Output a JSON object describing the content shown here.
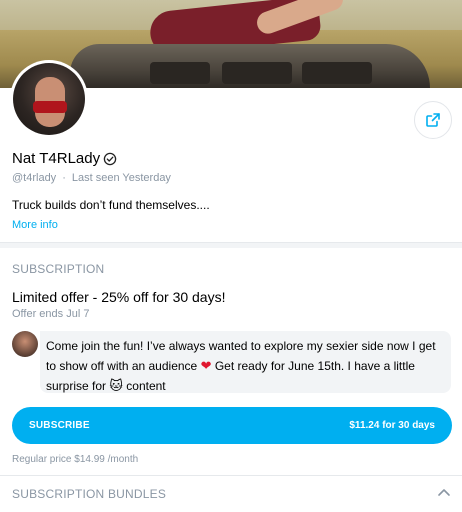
{
  "profile": {
    "display_name": "Nat T4RLady",
    "handle": "@t4rlady",
    "separator": "·",
    "last_seen": "Last seen Yesterday",
    "bio": "Truck builds don’t fund themselves....",
    "more_info_label": "More info"
  },
  "subscription": {
    "section_title": "SUBSCRIPTION",
    "offer_title": "Limited offer - 25% off for 30 days!",
    "offer_ends": "Offer ends Jul 7",
    "message_part1": "Come join the fun! I’ve always wanted to explore my sexier side now I get to show off with an audience",
    "message_part2": "Get ready for June 15th. I have a little surprise for",
    "message_part3": "content",
    "heart_emoji": "❤",
    "cat_emoji": "🐱",
    "subscribe_label": "SUBSCRIBE",
    "price_label": "$11.24 for 30 days",
    "regular_price": "Regular price $14.99 /month"
  },
  "bundles": {
    "section_title": "SUBSCRIPTION BUNDLES"
  },
  "icons": {
    "share": "share-icon",
    "verified": "verified-badge-icon",
    "collapse": "chevron-up-icon"
  },
  "colors": {
    "accent": "#00aff0",
    "muted_text": "#8a96a3",
    "heart": "#e0172f",
    "bubble_bg": "#f2f4f6"
  }
}
